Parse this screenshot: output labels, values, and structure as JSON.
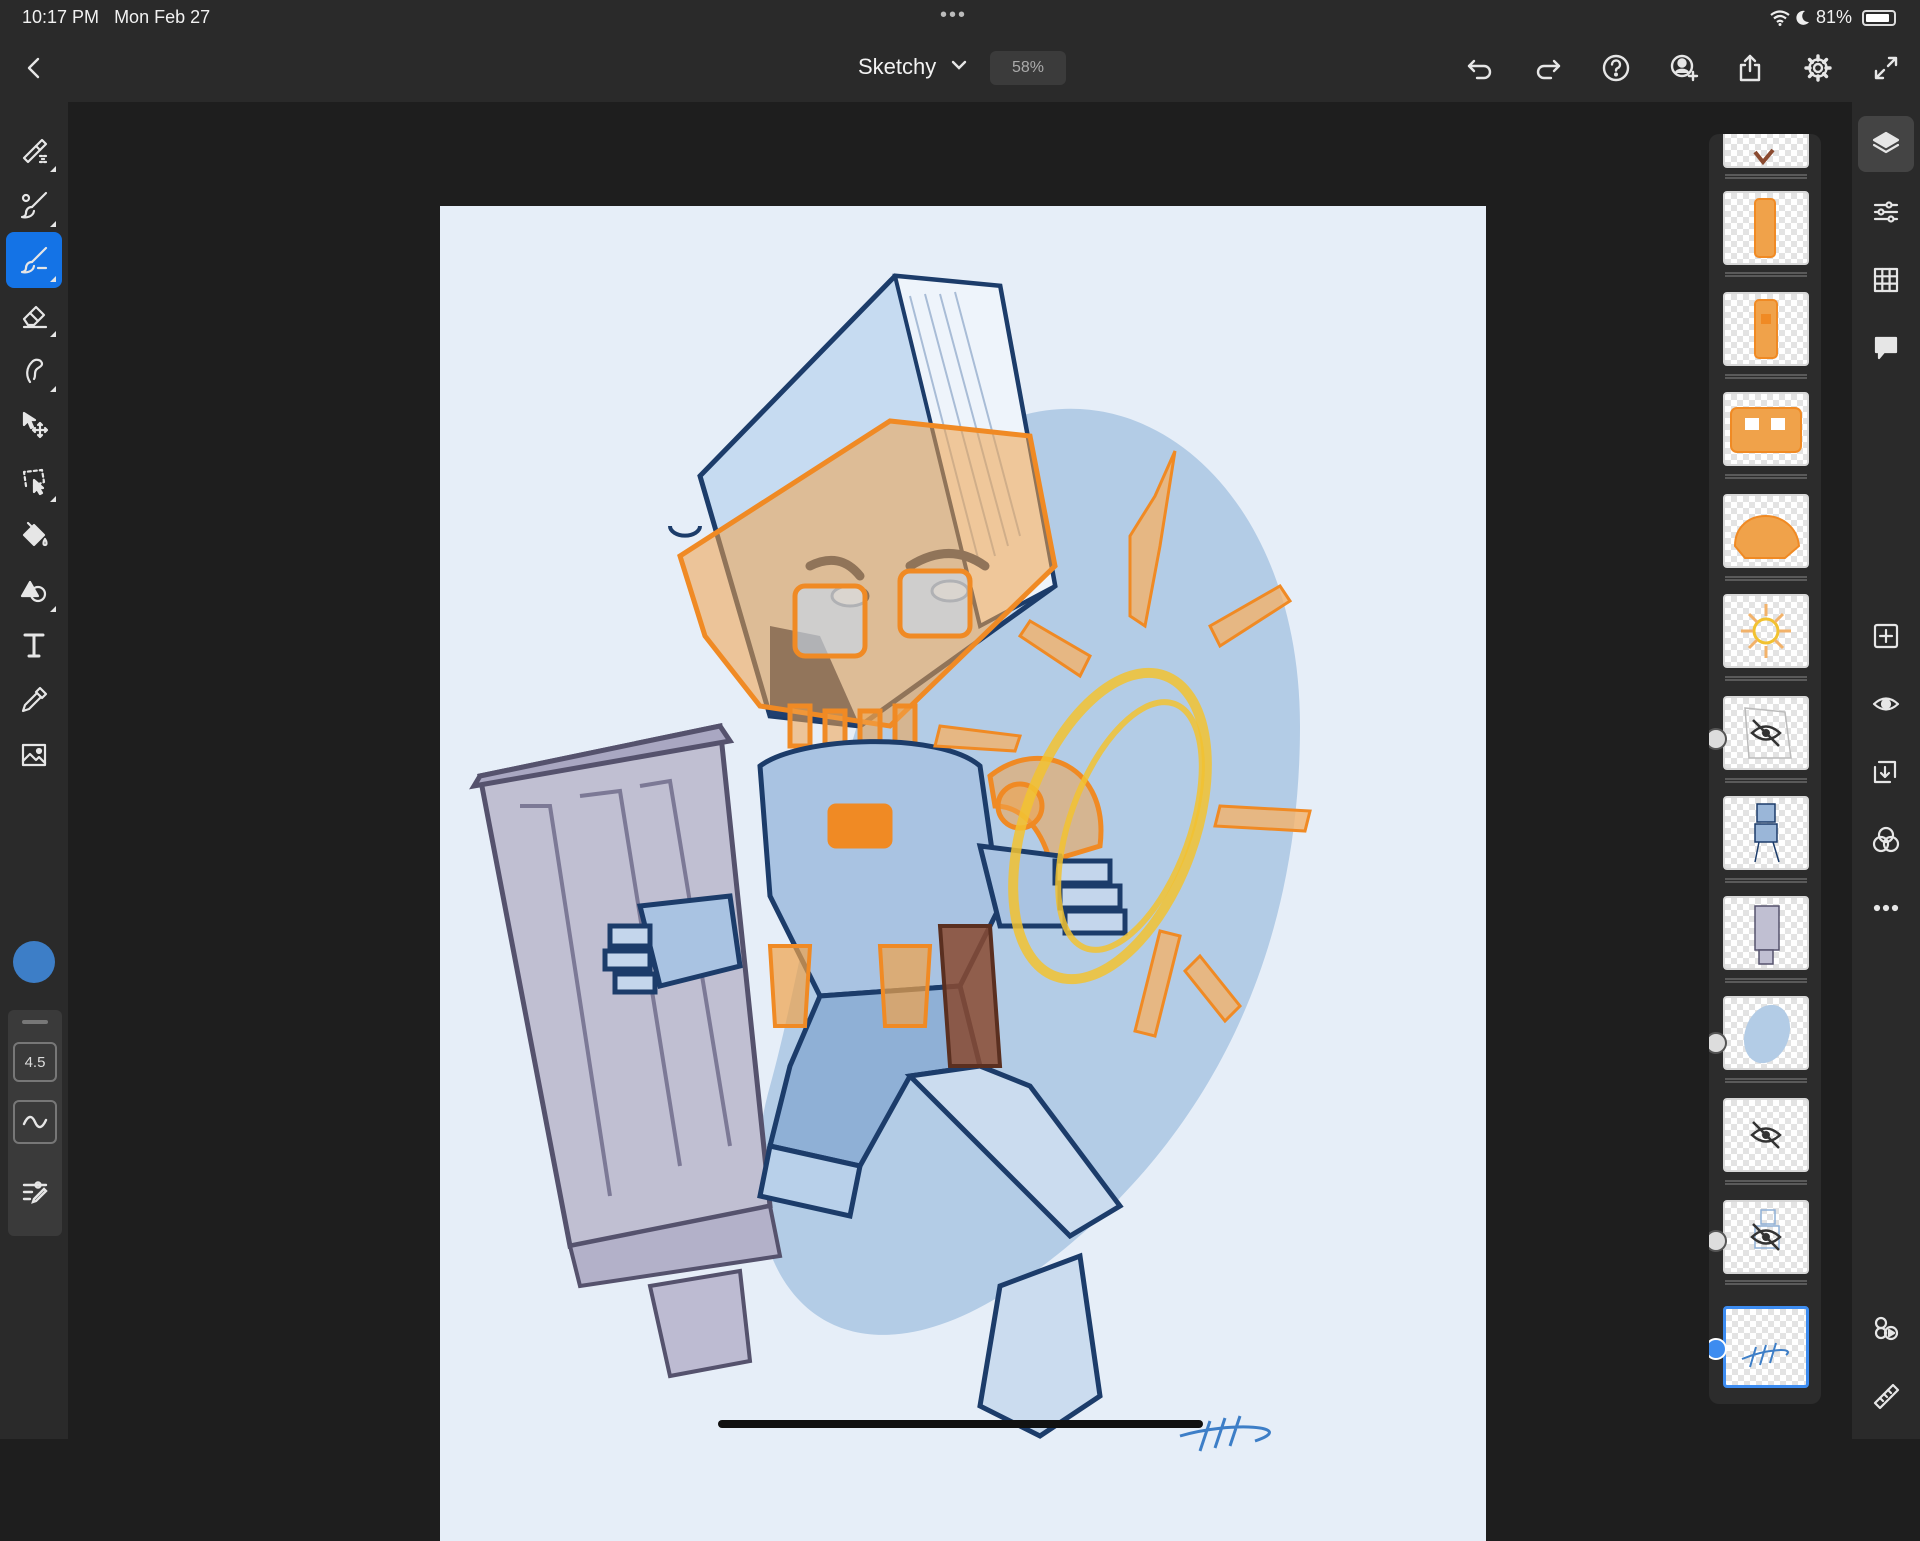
{
  "status_bar": {
    "time": "10:17 PM",
    "date": "Mon Feb 27",
    "battery": "81%",
    "icons": [
      "wifi-icon",
      "moon-icon",
      "battery-icon"
    ]
  },
  "toolbar": {
    "document_title": "Sketchy",
    "zoom": "58%",
    "icons": [
      "back-chevron-icon",
      "undo-icon",
      "redo-icon",
      "help-icon",
      "invite-icon",
      "share-icon",
      "gear-icon",
      "fullscreen-icon"
    ]
  },
  "tools": {
    "items": [
      "pixel-brush-icon",
      "live-brush-icon",
      "vector-brush-icon",
      "eraser-icon",
      "smudge-icon",
      "transform-icon",
      "selection-lasso-icon",
      "fill-icon",
      "shapes-icon",
      "text-icon",
      "eyedropper-icon",
      "image-icon"
    ],
    "active": "vector-brush-icon",
    "color": "#3d7ec7",
    "brush_size": "4.5"
  },
  "layers": {
    "count": 13,
    "selected_index": 12,
    "hidden": [
      6,
      10,
      11
    ]
  },
  "right_panel": {
    "icons": [
      "layers-icon",
      "layer-properties-icon",
      "grid-icon",
      "comments-icon",
      "add-layer-icon",
      "visibility-icon",
      "merge-down-icon",
      "blend-mode-icon",
      "more-icon",
      "timelapse-icon",
      "ruler-icon"
    ]
  },
  "colors": {
    "accent": "#1473e6",
    "artwork_orange": "#f08a24",
    "artwork_blue": "#9ab6d8",
    "artwork_yellow": "#f2c230"
  }
}
